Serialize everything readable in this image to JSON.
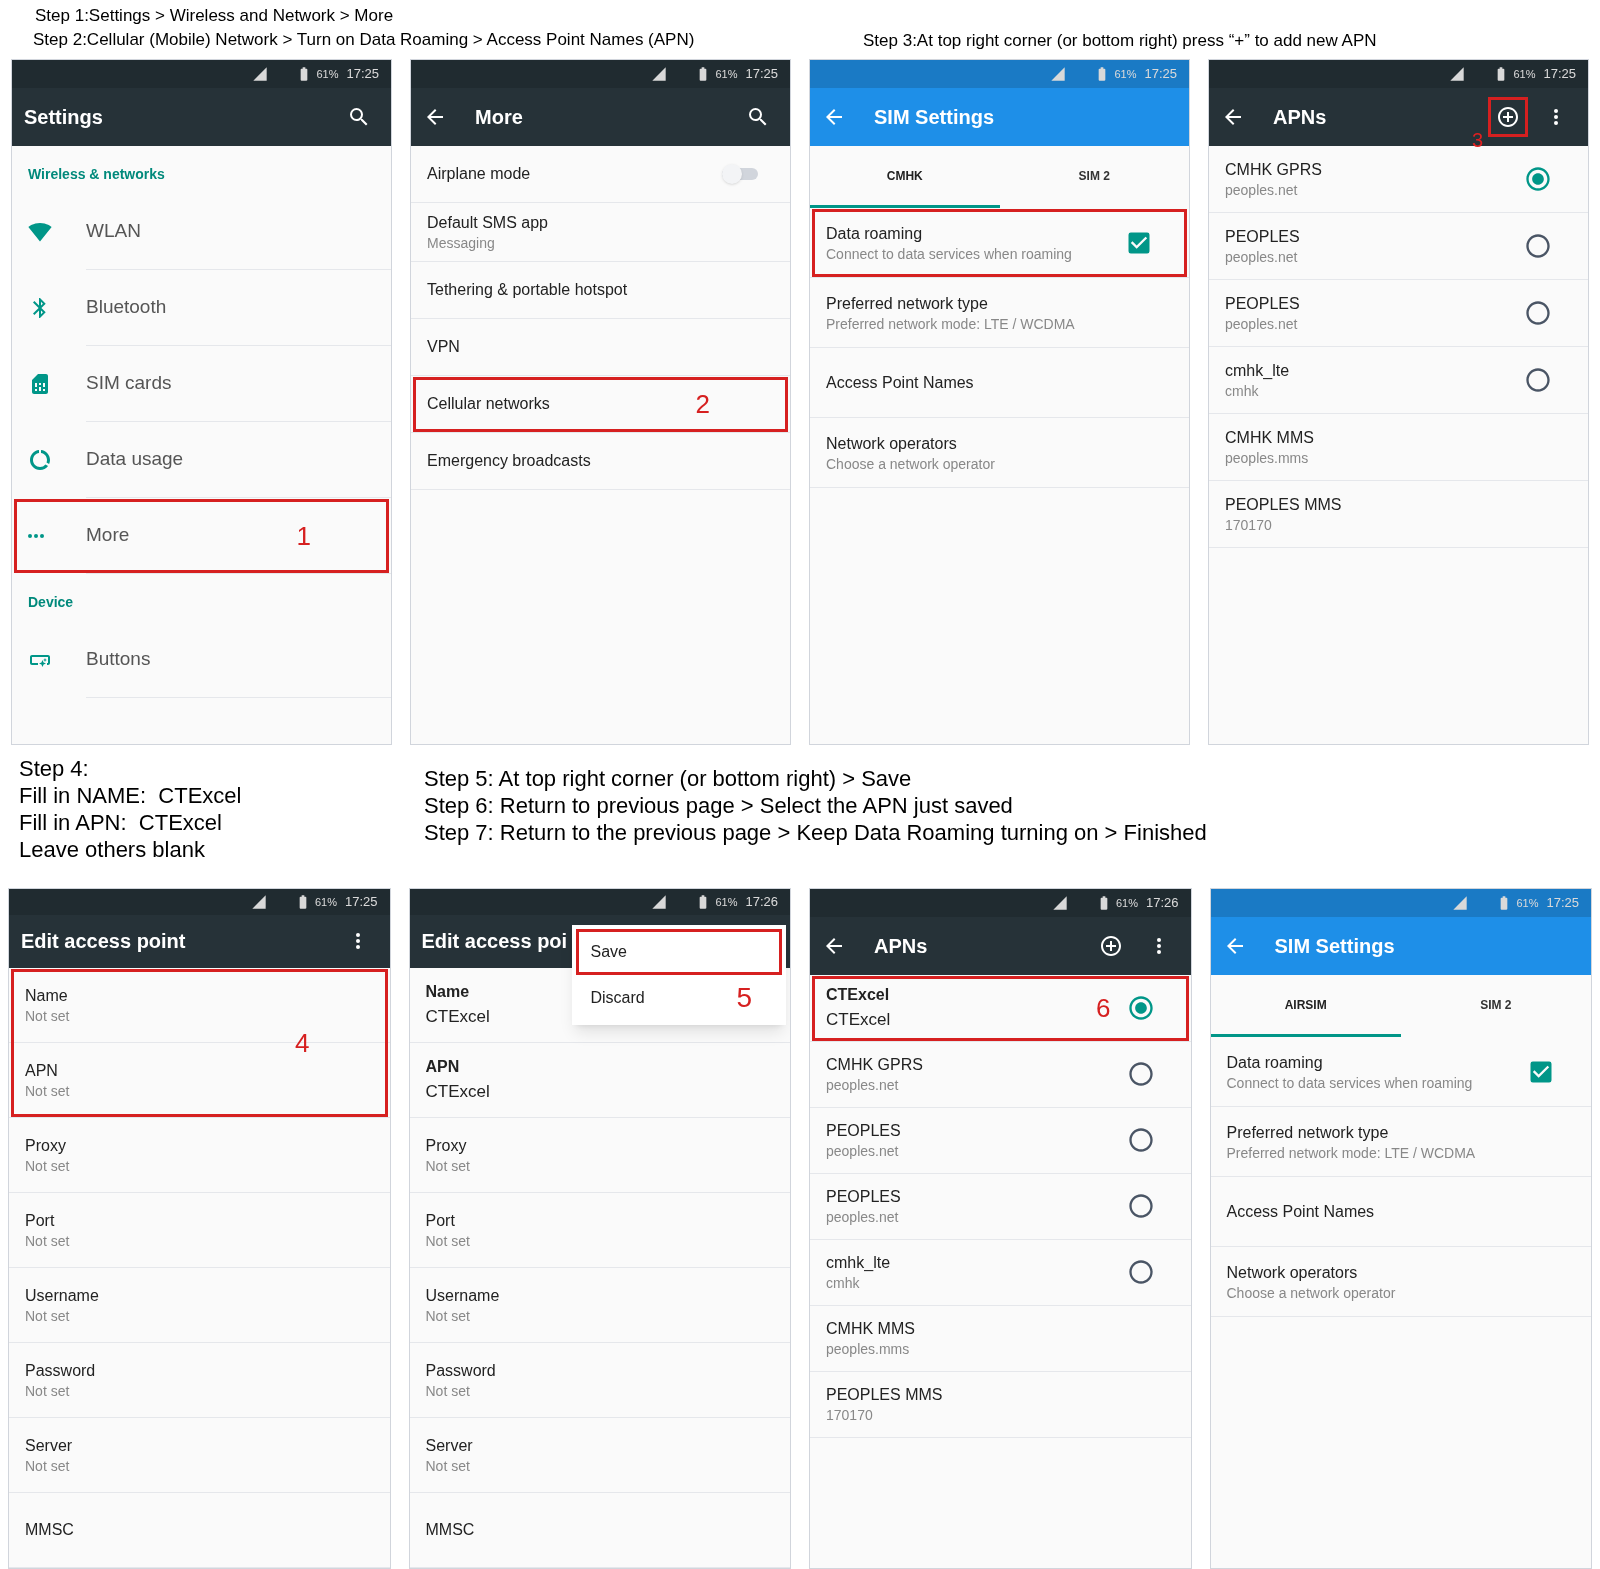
{
  "steps_top": [
    "Step 1:Settings > Wireless and Network > More",
    "Step 2:Cellular (Mobile) Network > Turn on Data Roaming > Access Point Names (APN)",
    "Step 3:At top right corner (or bottom right) press “+” to add new APN"
  ],
  "steps_middle_left": [
    "Step 4:",
    "Fill in NAME:  CTExcel",
    "Fill in APN:  CTExcel",
    "Leave others blank"
  ],
  "steps_middle_right": [
    "Step 5: At top right corner (or bottom right) > Save",
    "Step 6: Return to previous page > Select the APN just saved",
    "Step 7: Return to the previous page > Keep Data Roaming turning on > Finished"
  ],
  "screens": [
    {
      "color": "#263238",
      "battery": "61%",
      "time": "17:25",
      "title": "Settings",
      "back": false,
      "actions": [
        {
          "kind": "search"
        }
      ],
      "rows": [
        {
          "kind": "section",
          "text": "Wireless & networks"
        },
        {
          "kind": "icon_item",
          "label": "WLAN"
        },
        {
          "kind": "icon_item",
          "label": "Bluetooth"
        },
        {
          "kind": "icon_item",
          "label": "SIM cards"
        },
        {
          "kind": "icon_item",
          "label": "Data usage"
        },
        {
          "kind": "icon_item",
          "label": "More",
          "highlighted": true,
          "callout": "1"
        },
        {
          "kind": "section",
          "text": "Device"
        },
        {
          "kind": "icon_item",
          "label": "Buttons"
        }
      ]
    },
    {
      "color": "#263238",
      "battery": "61%",
      "time": "17:25",
      "title": "More",
      "back": true,
      "actions": [
        {
          "kind": "search"
        }
      ],
      "rows": [
        {
          "kind": "switch",
          "title": "Airplane mode",
          "on": false
        },
        {
          "kind": "item",
          "title": "Default SMS app",
          "subtitle": "Messaging"
        },
        {
          "kind": "item",
          "title": "Tethering & portable hotspot"
        },
        {
          "kind": "item",
          "title": "VPN"
        },
        {
          "kind": "item",
          "title": "Cellular networks",
          "highlighted": true,
          "callout": "2"
        },
        {
          "kind": "item",
          "title": "Emergency broadcasts"
        }
      ]
    },
    {
      "color": "#1e8fe8",
      "battery": "61%",
      "time": "17:25",
      "title": "SIM Settings",
      "back": true,
      "tabs": [
        {
          "label": "CMHK",
          "selected": true
        },
        {
          "label": "SIM 2",
          "selected": false
        }
      ],
      "rows": [
        {
          "kind": "checkbox",
          "title": "Data roaming",
          "subtitle": "Connect to data services when roaming",
          "checked": true,
          "highlighted": true
        },
        {
          "kind": "item",
          "title": "Preferred network type",
          "subtitle": "Preferred network mode: LTE / WCDMA"
        },
        {
          "kind": "item",
          "title": "Access Point Names"
        },
        {
          "kind": "item",
          "title": "Network operators",
          "subtitle": "Choose a network operator"
        }
      ]
    },
    {
      "color": "#263238",
      "battery": "61%",
      "time": "17:25",
      "title": "APNs",
      "back": true,
      "actions": [
        {
          "kind": "add",
          "highlighted": true,
          "callout": "3"
        },
        {
          "kind": "more"
        }
      ],
      "rows": [
        {
          "kind": "radio",
          "title": "CMHK GPRS",
          "subtitle": "peoples.net",
          "selected": true
        },
        {
          "kind": "radio",
          "title": "PEOPLES",
          "subtitle": "peoples.net",
          "selected": false
        },
        {
          "kind": "radio",
          "title": "PEOPLES",
          "subtitle": "peoples.net",
          "selected": false
        },
        {
          "kind": "radio",
          "title": "cmhk_lte",
          "subtitle": "cmhk",
          "selected": false
        },
        {
          "kind": "item",
          "title": "CMHK MMS",
          "subtitle": "peoples.mms"
        },
        {
          "kind": "item",
          "title": "PEOPLES MMS",
          "subtitle": "170170"
        }
      ]
    },
    {
      "color": "#263238",
      "battery": "61%",
      "time": "17:25",
      "title": "Edit access point",
      "back": false,
      "actions": [
        {
          "kind": "more"
        }
      ],
      "rows": [
        {
          "kind": "item",
          "title": "Name",
          "subtitle": "Not set",
          "highlighted": true,
          "callout": "4"
        },
        {
          "kind": "item",
          "title": "APN",
          "subtitle": "Not set",
          "highlighted": true
        },
        {
          "kind": "item",
          "title": "Proxy",
          "subtitle": "Not set"
        },
        {
          "kind": "item",
          "title": "Port",
          "subtitle": "Not set"
        },
        {
          "kind": "item",
          "title": "Username",
          "subtitle": "Not set"
        },
        {
          "kind": "item",
          "title": "Password",
          "subtitle": "Not set"
        },
        {
          "kind": "item",
          "title": "Server",
          "subtitle": "Not set"
        },
        {
          "kind": "item",
          "title": "MMSC"
        }
      ]
    },
    {
      "color": "#263238",
      "battery": "61%",
      "time": "17:26",
      "title": "Edit access poi",
      "back": false,
      "menu": {
        "callout": "5",
        "items": [
          {
            "label": "Save",
            "highlighted": true
          },
          {
            "label": "Discard",
            "highlighted": false
          }
        ]
      },
      "rows": [
        {
          "kind": "item",
          "title": "Name",
          "subtitle": "CTExcel",
          "value": true
        },
        {
          "kind": "item",
          "title": "APN",
          "subtitle": "CTExcel",
          "value": true
        },
        {
          "kind": "item",
          "title": "Proxy",
          "subtitle": "Not set"
        },
        {
          "kind": "item",
          "title": "Port",
          "subtitle": "Not set"
        },
        {
          "kind": "item",
          "title": "Username",
          "subtitle": "Not set"
        },
        {
          "kind": "item",
          "title": "Password",
          "subtitle": "Not set"
        },
        {
          "kind": "item",
          "title": "Server",
          "subtitle": "Not set"
        },
        {
          "kind": "item",
          "title": "MMSC"
        }
      ]
    },
    {
      "color": "#263238",
      "battery": "61%",
      "time": "17:26",
      "title": "APNs",
      "back": true,
      "actions": [
        {
          "kind": "add"
        },
        {
          "kind": "more"
        }
      ],
      "rows": [
        {
          "kind": "radio",
          "title": "CTExcel",
          "subtitle": "CTExcel",
          "value": true,
          "selected": true,
          "highlighted": true,
          "callout": "6"
        },
        {
          "kind": "radio",
          "title": "CMHK GPRS",
          "subtitle": "peoples.net",
          "selected": false
        },
        {
          "kind": "radio",
          "title": "PEOPLES",
          "subtitle": "peoples.net",
          "selected": false
        },
        {
          "kind": "radio",
          "title": "PEOPLES",
          "subtitle": "peoples.net",
          "selected": false
        },
        {
          "kind": "radio",
          "title": "cmhk_lte",
          "subtitle": "cmhk",
          "selected": false
        },
        {
          "kind": "item",
          "title": "CMHK MMS",
          "subtitle": "peoples.mms"
        },
        {
          "kind": "item",
          "title": "PEOPLES MMS",
          "subtitle": "170170"
        }
      ]
    },
    {
      "color": "#1e8fe8",
      "battery": "61%",
      "time": "17:25",
      "title": "SIM Settings",
      "back": true,
      "tabs": [
        {
          "label": "AIRSIM",
          "selected": true
        },
        {
          "label": "SIM 2",
          "selected": false
        }
      ],
      "rows": [
        {
          "kind": "checkbox",
          "title": "Data roaming",
          "subtitle": "Connect to data services when roaming",
          "checked": true
        },
        {
          "kind": "item",
          "title": "Preferred network type",
          "subtitle": "Preferred network mode: LTE / WCDMA"
        },
        {
          "kind": "item",
          "title": "Access Point Names"
        },
        {
          "kind": "item",
          "title": "Network operators",
          "subtitle": "Choose a network operator"
        }
      ]
    }
  ]
}
